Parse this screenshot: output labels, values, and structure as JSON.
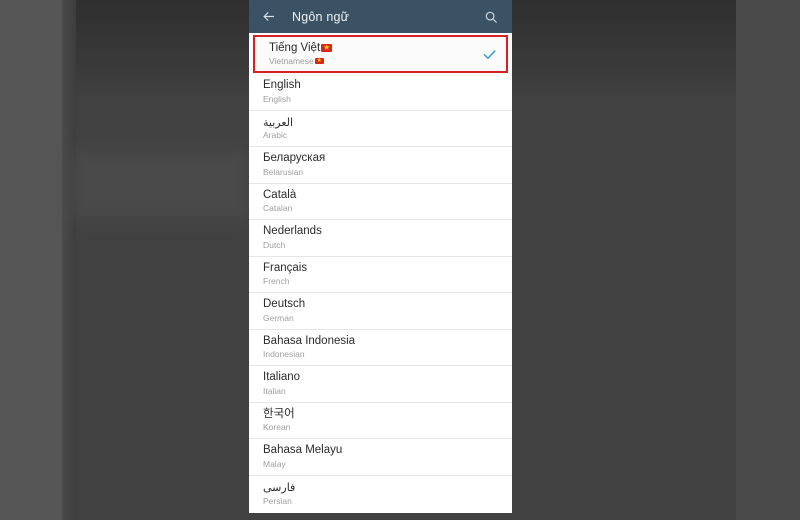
{
  "window": {
    "backdrop_color": "#414141",
    "panel_background": "#ffffff"
  },
  "appbar": {
    "back_icon": "arrow-left-icon",
    "title": "Ngôn ngữ",
    "search_icon": "search-icon",
    "background_color": "#3b5265",
    "title_color": "#eef2f5"
  },
  "highlight": {
    "border_color": "#d42027",
    "check_color": "#3d9ad1",
    "check_glyph": "✓"
  },
  "selected_language": {
    "native": "Tiếng Việt",
    "english": "Vietnamese",
    "flag_icon": "vietnam-flag-icon",
    "flag_color": "#da251d",
    "star_glyph": "★",
    "selected": true
  },
  "languages": [
    {
      "native": "English",
      "english": "English",
      "rtl": false
    },
    {
      "native": "العربية",
      "english": "Arabic",
      "rtl": true
    },
    {
      "native": "Беларуская",
      "english": "Belarusian",
      "rtl": false
    },
    {
      "native": "Català",
      "english": "Catalan",
      "rtl": false
    },
    {
      "native": "Nederlands",
      "english": "Dutch",
      "rtl": false
    },
    {
      "native": "Français",
      "english": "French",
      "rtl": false
    },
    {
      "native": "Deutsch",
      "english": "German",
      "rtl": false
    },
    {
      "native": "Bahasa Indonesia",
      "english": "Indonesian",
      "rtl": false
    },
    {
      "native": "Italiano",
      "english": "Italian",
      "rtl": false
    },
    {
      "native": "한국어",
      "english": "Korean",
      "rtl": false
    },
    {
      "native": "Bahasa Melayu",
      "english": "Malay",
      "rtl": false
    },
    {
      "native": "فارسی",
      "english": "Persian",
      "rtl": true
    }
  ]
}
